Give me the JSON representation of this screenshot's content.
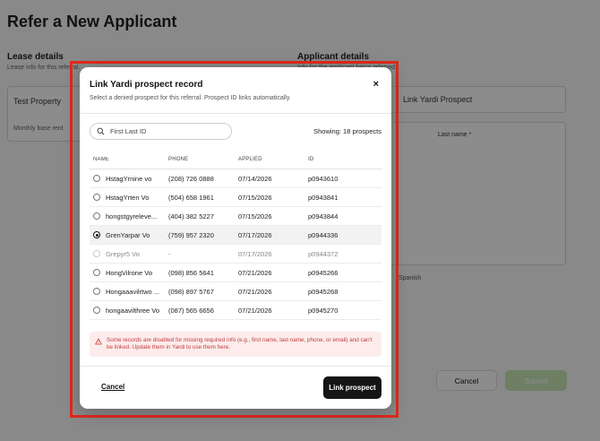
{
  "page": {
    "title": "Refer a New Applicant",
    "lease_section": "Lease details",
    "lease_sub": "Lease info for this referral.",
    "property_value": "Test Property",
    "monthly_label": "Monthly base rent",
    "applicant_section": "Applicant details",
    "applicant_sub": "Info for the applicant being referred.",
    "link_yardi_label": "Link Yardi Prospect",
    "last_name_label": "Last name *",
    "spanish_label": "Spanish",
    "cancel_label": "Cancel",
    "submit_label": "Submit"
  },
  "modal": {
    "title": "Link Yardi prospect record",
    "subtitle": "Select a denied prospect for this referral. Prospect ID links automatically.",
    "close": "×",
    "search_placeholder": "First Last ID",
    "showing": "Showing: 18 prospects",
    "columns": {
      "name": "NAME",
      "phone": "PHONE",
      "applied": "APPLIED",
      "id": "ID"
    },
    "rows": [
      {
        "name": "HstagYrnine vo",
        "phone": "(208) 726 0888",
        "applied": "07/14/2026",
        "id": "p0943610"
      },
      {
        "name": "HstagYrten Vo",
        "phone": "(504) 658 1961",
        "applied": "07/15/2026",
        "id": "p0943841"
      },
      {
        "name": "hongstgyreleve...",
        "phone": "(404) 382 5227",
        "applied": "07/15/2026",
        "id": "p0943844"
      },
      {
        "name": "GrenYarpar Vo",
        "phone": "(759) 957 2320",
        "applied": "07/17/2026",
        "id": "p0944336"
      },
      {
        "name": "Grepyr5 Vo",
        "phone": "-",
        "applied": "07/17/2026",
        "id": "p0944372"
      },
      {
        "name": "HongVilrone Vo",
        "phone": "(098) 856 5641",
        "applied": "07/21/2026",
        "id": "p0945266"
      },
      {
        "name": "Hongaaavilrtwo ...",
        "phone": "(098) 897 5767",
        "applied": "07/21/2026",
        "id": "p0945268"
      },
      {
        "name": "hongaavilthree Vo",
        "phone": "(087) 565 6656",
        "applied": "07/21/2026",
        "id": "p0945270"
      }
    ],
    "selected_index": 3,
    "disabled_index": 4,
    "warning": "Some records are disabled for missing required info (e.g., first name, last name, phone, or email) and can't be linked. Update them in Yardi to use them here.",
    "cancel": "Cancel",
    "link_button": "Link prospect"
  },
  "colors": {
    "highlight": "#e0291b",
    "primary": "#151515",
    "warning_bg": "#fdecec",
    "warning_text": "#c13b3b"
  }
}
